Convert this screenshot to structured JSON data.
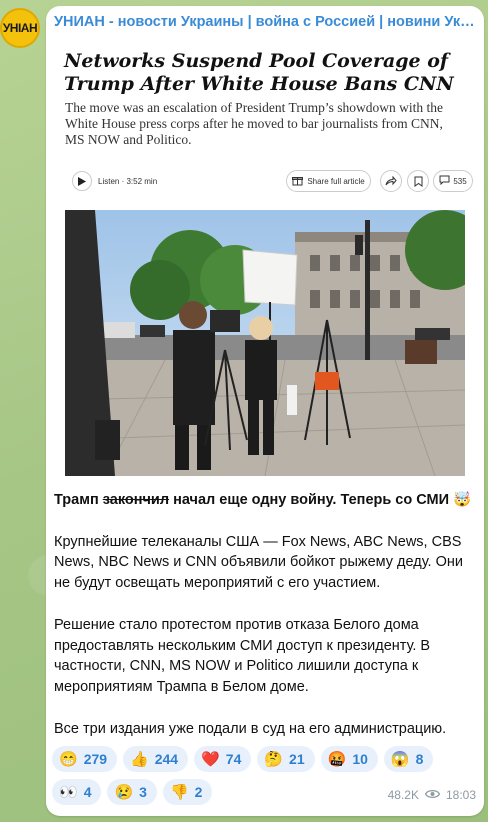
{
  "channel": {
    "avatar_text": "УНІАН",
    "name": "УНИАН - новости Украины | война с Россией | новини Україні..."
  },
  "article": {
    "headline": "Networks Suspend Pool Coverage of Trump After White House Bans CNN",
    "dek": "The move was an escalation of President Trump’s showdown with the White House press corps after he moved to bar journalists from CNN, MS NOW and Politico.",
    "listen_label": "Listen · 3:52 min",
    "share_label": "Share full article",
    "comments_count": "535"
  },
  "post": {
    "lead_before": "Трамп ",
    "lead_struck": "закончил",
    "lead_after": " начал еще одну войну. Теперь со СМИ",
    "lead_emoji": "🤯",
    "para1": "Крупнейшие телеканалы США — Fox News, ABC News, CBS News, NBC News и CNN объявили бойкот рыжему деду. Они не будут освещать мероприятий с его участием.",
    "para2": "Решение стало протестом против отказа Белого дома предоставлять нескольким СМИ доступ к президенту. В частности, CNN, MS NOW и Politico лишили доступа к мероприятиям Трампа в Белом доме.",
    "para3": "Все три издания уже подали в суд на его администрацию."
  },
  "reactions": [
    {
      "emoji": "😁",
      "count": "279"
    },
    {
      "emoji": "👍",
      "count": "244"
    },
    {
      "emoji": "❤️",
      "count": "74"
    },
    {
      "emoji": "🤔",
      "count": "21"
    },
    {
      "emoji": "🤬",
      "count": "10"
    },
    {
      "emoji": "😱",
      "count": "8"
    },
    {
      "emoji": "👀",
      "count": "4"
    },
    {
      "emoji": "😢",
      "count": "3"
    },
    {
      "emoji": "👎",
      "count": "2"
    }
  ],
  "meta": {
    "views": "48.2K",
    "time": "18:03"
  },
  "colors": {
    "channel_name": "#3a8bd6",
    "reaction_bg": "#e8f1fb",
    "reaction_text": "#2f7fd0",
    "meta_text": "#8e9aa3"
  }
}
